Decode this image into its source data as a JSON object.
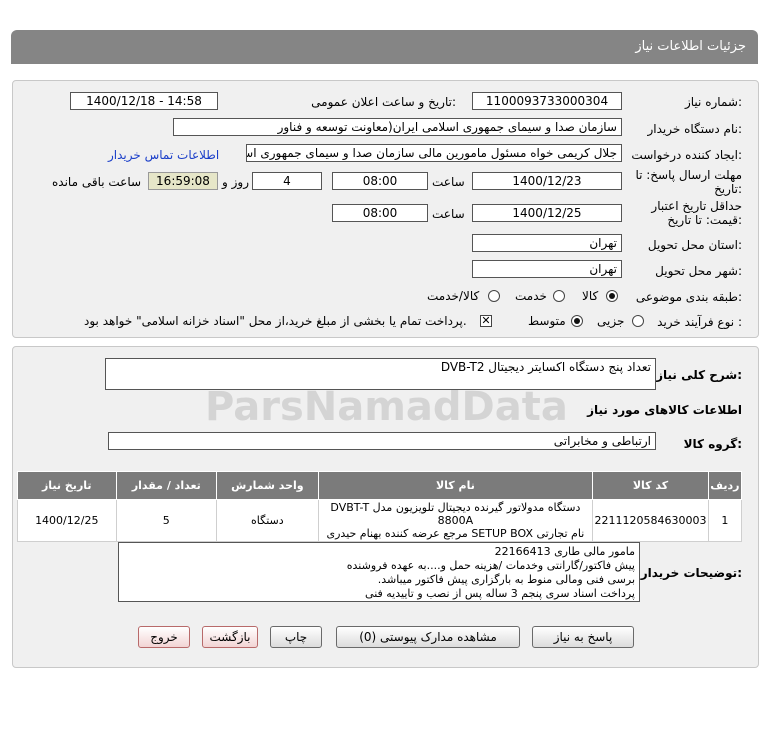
{
  "header": {
    "title": "جزئیات اطلاعات نیاز"
  },
  "form": {
    "need_number_label": "شماره نیاز:",
    "need_number": "1100093733000304",
    "announce_label": "تاریخ و ساعت اعلان عمومی:",
    "announce_value": "1400/12/18 - 14:58",
    "buyer_org_label": "نام دستگاه خریدار:",
    "buyer_org": "سازمان صدا و سیمای جمهوری اسلامی ایران(معاونت توسعه و فناور",
    "creator_label": "ایجاد کننده درخواست:",
    "creator": "جلال کریمی خواه مسئول مامورین مالی  سازمان صدا و سیمای جمهوری اسلا",
    "contact_link": "اطلاعات تماس خریدار",
    "deadline_label_1": "مهلت ارسال پاسخ: تا",
    "deadline_label_2": "تاریخ:",
    "deadline_date": "1400/12/23",
    "time_label": "ساعت",
    "deadline_time": "08:00",
    "days_value": "4",
    "days_label": "روز و",
    "remaining_time": "16:59:08",
    "remaining_label": "ساعت باقی مانده",
    "validity_label_1": "حداقل تاریخ اعتبار",
    "validity_label_2": "قیمت: تا تاریخ:",
    "validity_date": "1400/12/25",
    "validity_time": "08:00",
    "delivery_province_label": "استان محل تحویل:",
    "delivery_province": "تهران",
    "delivery_city_label": "شهر محل تحویل:",
    "delivery_city": "تهران",
    "category_label": "طبقه بندی موضوعی:",
    "category_options": [
      "کالا",
      "خدمت",
      "کالا/خدمت"
    ],
    "process_label": "نوع فرآیند خرید :",
    "process_options": [
      "جزیی",
      "متوسط"
    ],
    "payment_note": "پرداخت تمام یا بخشی از مبلغ خرید،از محل \"اسناد خزانه اسلامی\" خواهد بود."
  },
  "summary": {
    "label": "شرح کلی نیاز:",
    "value": "تعداد پنج دستگاه اکسایتر دیجیتال DVB-T2"
  },
  "goods": {
    "section_title": "اطلاعات کالاهای مورد نیاز",
    "group_label": "گروه کالا:",
    "group_value": "ارتباطی و مخابراتی",
    "columns": [
      "ردیف",
      "کد کالا",
      "نام کالا",
      "واحد شمارش",
      "تعداد / مقدار",
      "تاریخ نیاز"
    ],
    "rows": [
      {
        "row": "1",
        "code": "2211120584630003",
        "name_line1": "دستگاه مدولاتور گیرنده دیجیتال تلویزیون مدل DVBT-T 8800A",
        "name_line2": "نام تجارتی SETUP BOX مرجع عرضه کننده بهنام حیدری",
        "unit": "دستگاه",
        "qty": "5",
        "date": "1400/12/25"
      }
    ]
  },
  "buyer_notes": {
    "label": "توضیحات خریدار:",
    "lines": [
      "مامور مالی طاری 22166413",
      "پیش فاکتور/گارانتی وخدمات /هزینه حمل و....به عهده فروشنده",
      "برسی فنی ومالی منوط به بارگزاری پیش فاکتور میباشد.",
      "پرداخت اسناد سری پنجم 3 ساله پس از نصب و تاییدیه فنی"
    ]
  },
  "buttons": {
    "reply": "پاسخ به نیاز",
    "attachments": "مشاهده مدارک پیوستی (0)",
    "print": "چاپ",
    "back": "بازگشت",
    "exit": "خروج"
  },
  "watermark": {
    "brand": "ParsNamadData"
  },
  "colors": {
    "header_bg": "#858585",
    "panel_bg": "#f0f0f0",
    "table_header_bg": "#7b7b7b",
    "link": "#1a3ec9",
    "remaining_bg": "#e6e6c8"
  }
}
